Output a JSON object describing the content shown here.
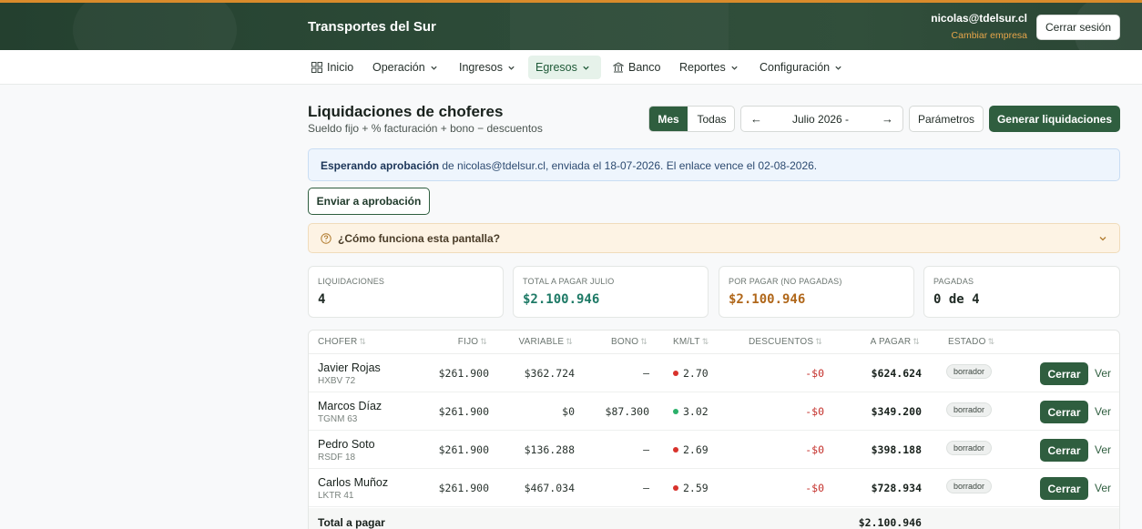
{
  "app": {
    "name": "Transportes del Sur",
    "user_email": "nicolas@tdelsur.cl",
    "change_company": "Cambiar empresa",
    "logout": "Cerrar sesión"
  },
  "nav": {
    "items": [
      {
        "label": "Inicio",
        "icon": "grid-icon"
      },
      {
        "label": "Operación",
        "icon": "chevron-down-icon"
      },
      {
        "label": "Ingresos",
        "icon": "chevron-down-icon"
      },
      {
        "label": "Egresos",
        "icon": "chevron-down-icon",
        "active": true
      },
      {
        "label": "Banco",
        "icon": "bank-icon"
      },
      {
        "label": "Reportes",
        "icon": "chevron-down-icon"
      },
      {
        "label": "Configuración",
        "icon": "chevron-down-icon"
      }
    ]
  },
  "page": {
    "title": "Liquidaciones de choferes",
    "subtitle": "Sueldo fijo + % facturación + bono − descuentos"
  },
  "toolbar": {
    "mode_month": "Mes",
    "mode_all": "Todas",
    "prev_arrow": "←",
    "next_arrow": "→",
    "month_label": "Julio 2026 -",
    "params": "Parámetros",
    "generate": "Generar liquidaciones"
  },
  "banner": {
    "strong": "Esperando aprobación",
    "text": " de nicolas@tdelsur.cl, enviada el 18-07-2026. El enlace vence el 02-08-2026."
  },
  "send_approval": "Enviar a aprobación",
  "help": {
    "question": "¿Cómo funciona esta pantalla?"
  },
  "kpis": [
    {
      "label": "Liquidaciones",
      "value": "4"
    },
    {
      "label": "Total a pagar julio",
      "value": "$2.100.946"
    },
    {
      "label": "Por pagar (no pagadas)",
      "value": "$2.100.946"
    },
    {
      "label": "Pagadas",
      "value": "0 de 4"
    }
  ],
  "table": {
    "columns": [
      "Chofer",
      "Fijo",
      "Variable",
      "Bono",
      "Km/Lt",
      "Descuentos",
      "A pagar",
      "Estado"
    ],
    "sort_glyph": "⇅",
    "rows": [
      {
        "name": "Javier Rojas",
        "plate": "HXBV 72",
        "fijo": "$261.900",
        "variable": "$362.724",
        "bono": "—",
        "kml": "2.70",
        "kml_status": "red",
        "descuentos": "-$0",
        "a_pagar": "$624.624",
        "estado": "borrador",
        "action": "Cerrar",
        "link": "Ver"
      },
      {
        "name": "Marcos Díaz",
        "plate": "TGNM 63",
        "fijo": "$261.900",
        "variable": "$0",
        "bono": "$87.300",
        "kml": "3.02",
        "kml_status": "green",
        "descuentos": "-$0",
        "a_pagar": "$349.200",
        "estado": "borrador",
        "action": "Cerrar",
        "link": "Ver"
      },
      {
        "name": "Pedro Soto",
        "plate": "RSDF 18",
        "fijo": "$261.900",
        "variable": "$136.288",
        "bono": "—",
        "kml": "2.69",
        "kml_status": "red",
        "descuentos": "-$0",
        "a_pagar": "$398.188",
        "estado": "borrador",
        "action": "Cerrar",
        "link": "Ver"
      },
      {
        "name": "Carlos Muñoz",
        "plate": "LKTR 41",
        "fijo": "$261.900",
        "variable": "$467.034",
        "bono": "—",
        "kml": "2.59",
        "kml_status": "red",
        "descuentos": "-$0",
        "a_pagar": "$728.934",
        "estado": "borrador",
        "action": "Cerrar",
        "link": "Ver"
      }
    ],
    "total_label": "Total a pagar",
    "total_value": "$2.100.946"
  },
  "colors": {
    "brand_green": "#2f5e3f",
    "accent_orange": "#d98b2b",
    "negative_red": "#c4302b",
    "teal": "#1e7a66",
    "amber": "#b0671a"
  }
}
